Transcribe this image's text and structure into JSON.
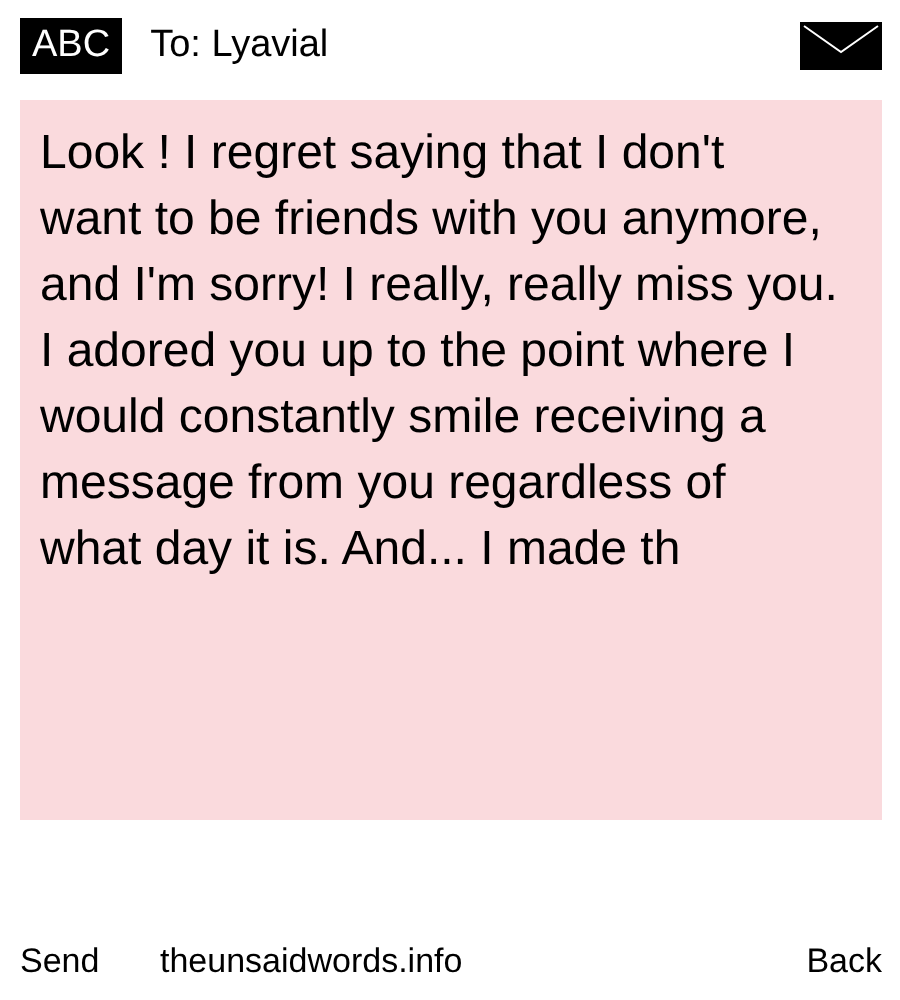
{
  "header": {
    "input_mode": "ABC",
    "recipient": "To: Lyavial"
  },
  "message": {
    "text": "Look ! I regret saying that I don't want to be friends with you anymore, and I'm sorry! I really, really miss you. I adored you up to the point where I would constantly smile receiving a message from you regardless of what day it is. And... I made th"
  },
  "softkeys": {
    "left": "Send",
    "middle": "theunsaidwords.info",
    "right": "Back"
  }
}
